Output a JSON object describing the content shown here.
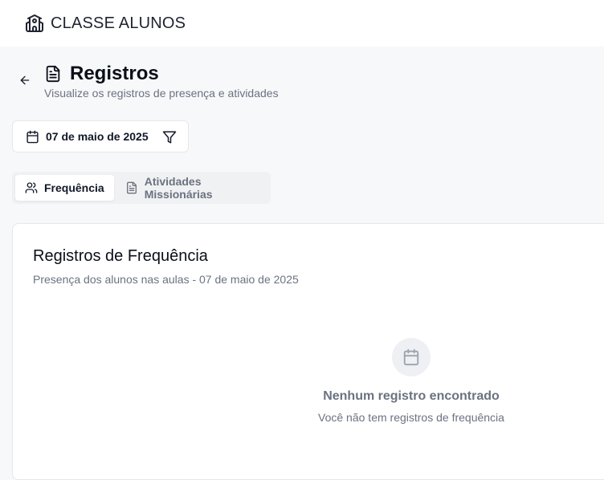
{
  "app": {
    "name": "CLASSE ALUNOS",
    "icon": "school-icon"
  },
  "header": {
    "back_icon": "arrow-left-icon",
    "title_icon": "document-icon",
    "title": "Registros",
    "subtitle": "Visualize os registros de presença e atividades"
  },
  "filters": {
    "date_icon": "calendar-icon",
    "date": "07 de maio de 2025",
    "filter_icon": "filter-icon"
  },
  "tabs": [
    {
      "label": "Frequência",
      "icon": "users-icon",
      "active": true
    },
    {
      "label": "Atividades Missionárias",
      "icon": "document-icon",
      "active": false
    }
  ],
  "card": {
    "title": "Registros de Frequência",
    "subtitle": "Presença dos alunos nas aulas - 07 de maio de 2025",
    "empty": {
      "icon": "calendar-icon",
      "title": "Nenhum registro encontrado",
      "text": "Você não tem registros de frequência"
    }
  },
  "colors": {
    "background": "#f7f8fa",
    "surface": "#ffffff",
    "border": "#e5e7eb",
    "muted_text": "#6b7280",
    "text": "#111827"
  }
}
